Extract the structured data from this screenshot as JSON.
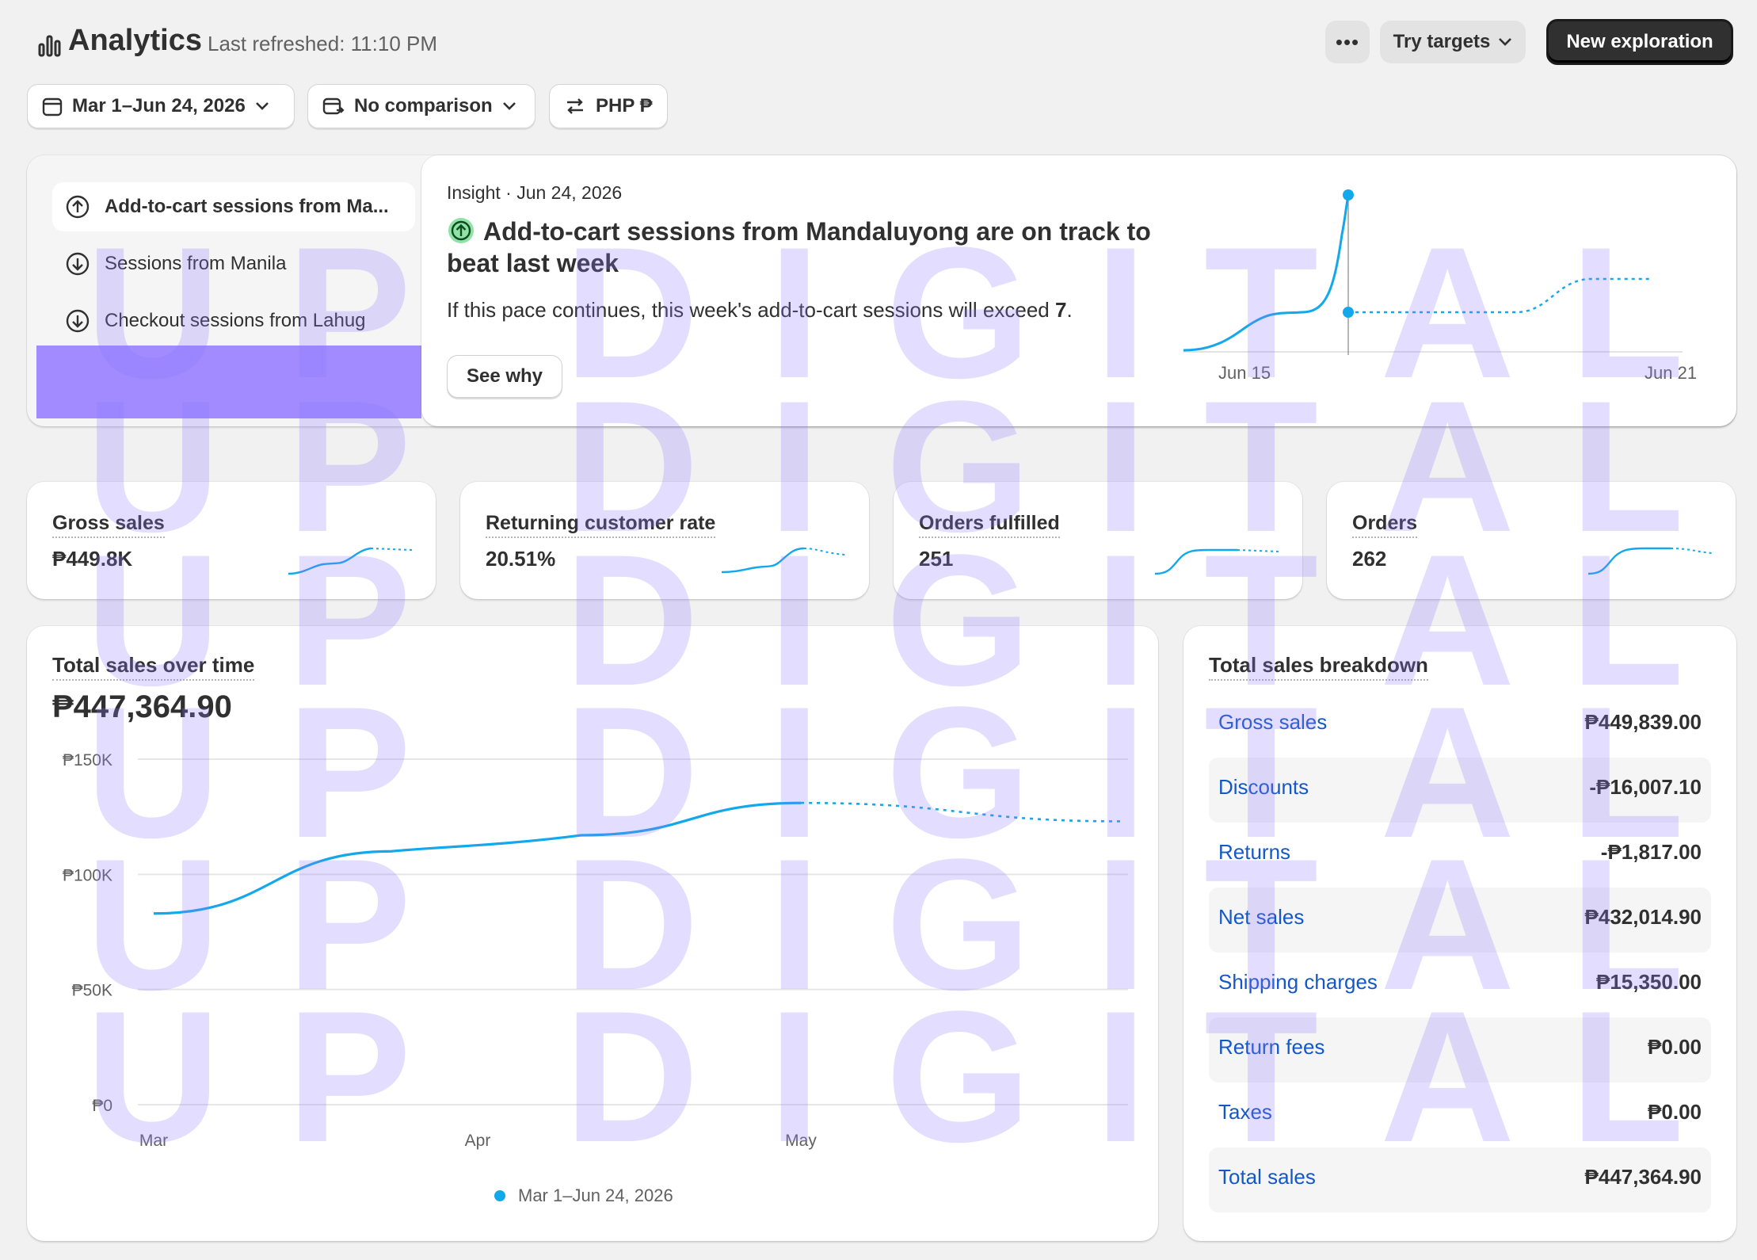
{
  "header": {
    "icon": "analytics-icon",
    "title": "Analytics",
    "last_refreshed": "Last refreshed: 11:10 PM",
    "more_label": "•••",
    "try_targets_label": "Try targets",
    "new_exploration_label": "New exploration"
  },
  "filters": {
    "date_range": "Mar 1–Jun 24, 2026",
    "comparison": "No comparison",
    "currency": "PHP ₱"
  },
  "insights": {
    "items": [
      {
        "label": "Add-to-cart sessions from Ma...",
        "direction": "up",
        "active": true
      },
      {
        "label": "Sessions from Manila",
        "direction": "down",
        "active": false
      },
      {
        "label": "Checkout sessions from Lahug",
        "direction": "down",
        "active": false
      }
    ],
    "date_line": "Insight · Jun 24, 2026",
    "title": "Add-to-cart sessions from Mandaluyong are on track to beat last week",
    "body_prefix": "If this pace continues, this week's add-to-cart sessions will exceed ",
    "body_value": "7",
    "body_suffix": ".",
    "see_why_label": "See why",
    "chart_x_labels": [
      "Jun 15",
      "Jun 21"
    ]
  },
  "kpis": [
    {
      "label": "Gross sales",
      "value": "₱449.8K"
    },
    {
      "label": "Returning customer rate",
      "value": "20.51%"
    },
    {
      "label": "Orders fulfilled",
      "value": "251"
    },
    {
      "label": "Orders",
      "value": "262"
    }
  ],
  "sales_over_time": {
    "title": "Total sales over time",
    "total": "₱447,364.90",
    "legend": "Mar 1–Jun 24, 2026"
  },
  "chart_data": {
    "type": "line",
    "title": "Total sales over time",
    "xlabel": "",
    "ylabel": "",
    "y_ticks": [
      "₱150K",
      "₱100K",
      "₱50K",
      "₱0"
    ],
    "y_tick_values": [
      150000,
      100000,
      50000,
      0
    ],
    "x_ticks": [
      "Mar",
      "Apr",
      "May"
    ],
    "ylim": [
      0,
      150000
    ],
    "grid": true,
    "legend_position": "bottom",
    "series": [
      {
        "name": "Mar 1–Jun 24, 2026",
        "color": "#13a7ec",
        "x": [
          "Mar",
          "Apr",
          "May",
          "Jun"
        ],
        "values": [
          83000,
          113000,
          131000,
          123000
        ],
        "dashed_from_index": 2
      }
    ]
  },
  "breakdown": {
    "title": "Total sales breakdown",
    "rows": [
      {
        "label": "Gross sales",
        "value": "₱449,839.00"
      },
      {
        "label": "Discounts",
        "value": "-₱16,007.10"
      },
      {
        "label": "Returns",
        "value": "-₱1,817.00"
      },
      {
        "label": "Net sales",
        "value": "₱432,014.90"
      },
      {
        "label": "Shipping charges",
        "value": "₱15,350.00"
      },
      {
        "label": "Return fees",
        "value": "₱0.00"
      },
      {
        "label": "Taxes",
        "value": "₱0.00"
      },
      {
        "label": "Total sales",
        "value": "₱447,364.90"
      }
    ]
  },
  "watermark": {
    "letters": [
      "U",
      "P",
      "D",
      "I",
      "G",
      "I",
      "T",
      "A",
      "L"
    ]
  },
  "colors": {
    "accent_line": "#13a7ec",
    "link": "#1458c7",
    "primary_button": "#303030",
    "watermark": "#9176ff",
    "highlight_block": "#a18bff"
  }
}
